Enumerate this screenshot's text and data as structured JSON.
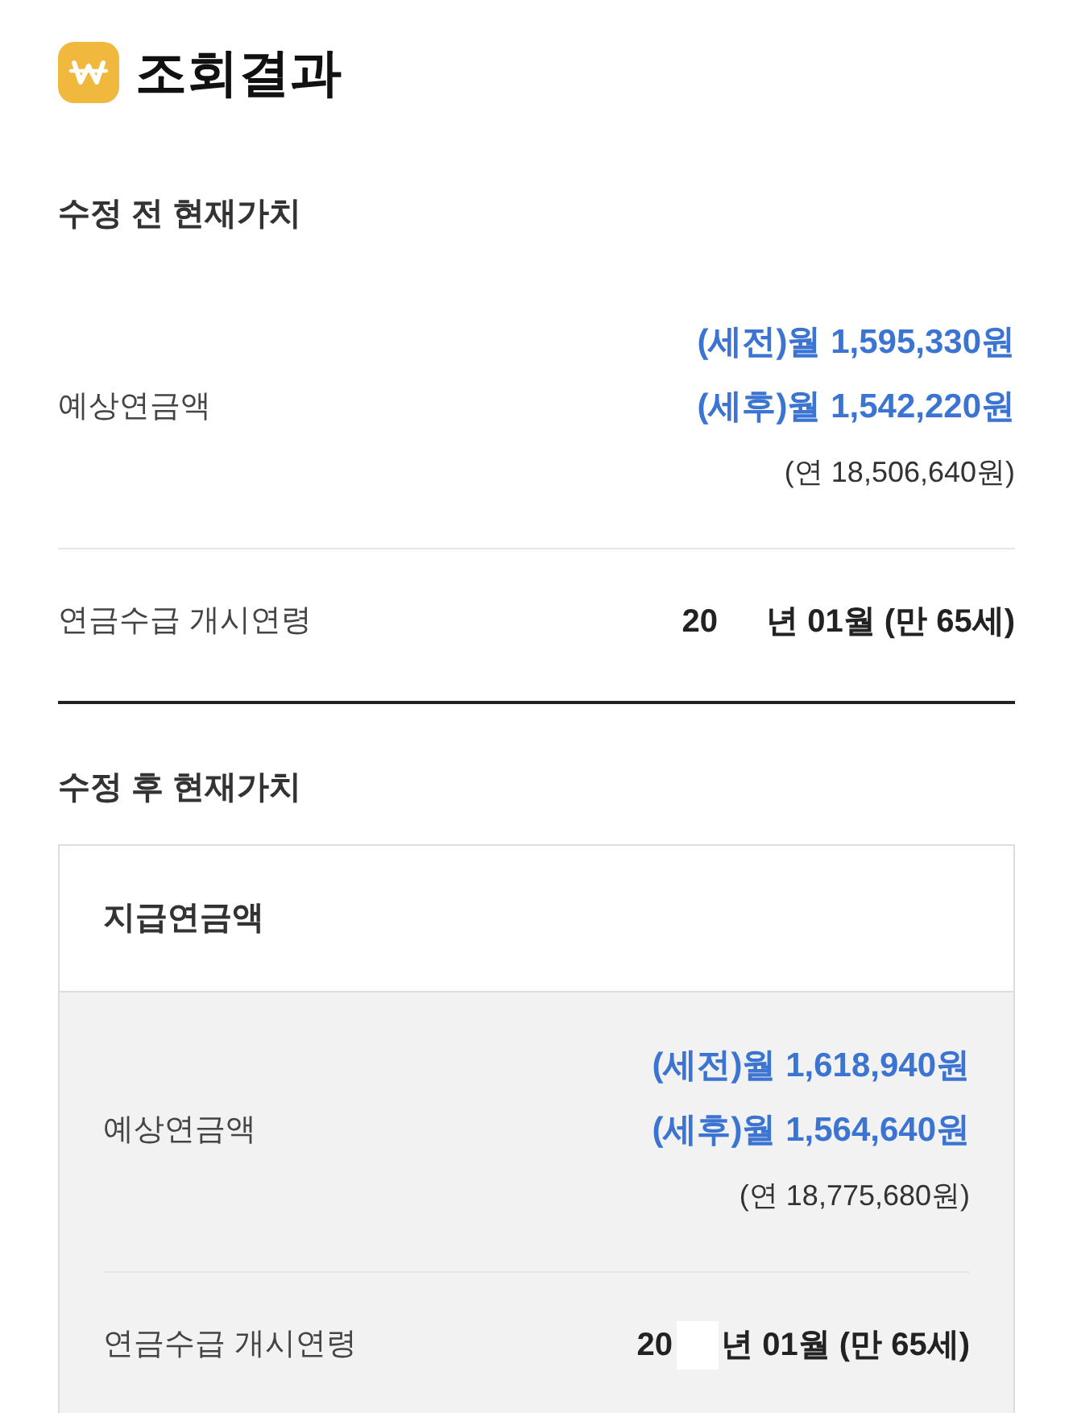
{
  "header": {
    "title": "조회결과"
  },
  "sections": [
    {
      "kind": "plain",
      "title": "수정 전 현재가치",
      "rows": [
        {
          "kind": "amount",
          "label": "예상연금액",
          "pre_tax": "(세전)월 1,595,330원",
          "post_tax": "(세후)월 1,542,220원",
          "annual": "(연 18,506,640원)"
        },
        {
          "kind": "start_age",
          "label": "연금수급 개시연령",
          "year_prefix": "20",
          "masked": true,
          "value": "년 01월 (만 65세)"
        }
      ]
    },
    {
      "kind": "card",
      "title": "수정 후 현재가치",
      "card_title": "지급연금액",
      "rows": [
        {
          "kind": "amount",
          "label": "예상연금액",
          "pre_tax": "(세전)월 1,618,940원",
          "post_tax": "(세후)월 1,564,640원",
          "annual": "(연 18,775,680원)"
        },
        {
          "kind": "start_age",
          "label": "연금수급 개시연령",
          "year_prefix": "20",
          "masked": true,
          "value": "년 01월 (만 65세)"
        }
      ]
    }
  ]
}
